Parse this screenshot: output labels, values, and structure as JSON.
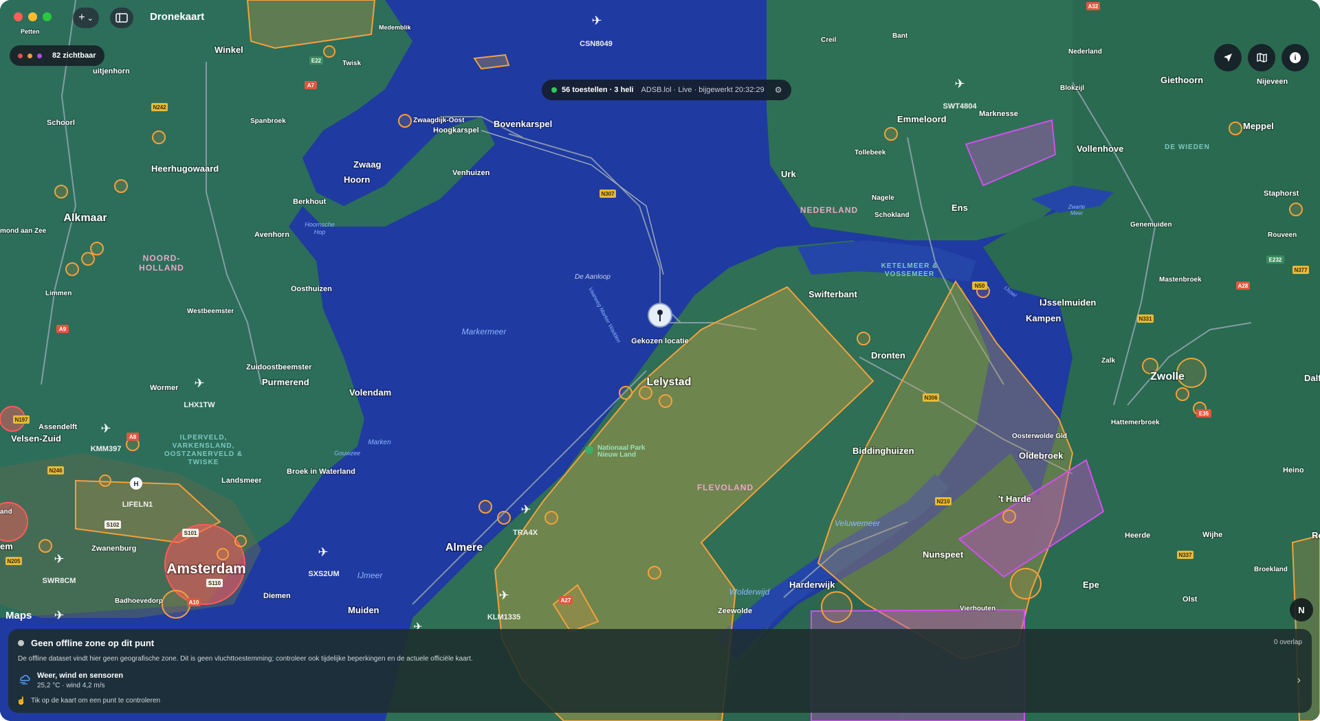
{
  "window": {
    "title": "Dronekaart"
  },
  "toolbar": {
    "add_label": "+",
    "add_chevron": "⌄",
    "sidebar_icon": "sidebar-icon"
  },
  "visible_pill": {
    "text": "82 zichtbaar",
    "dot_colors": [
      "#e14f4f",
      "#f09a3a",
      "#b04ee0"
    ]
  },
  "status_pill": {
    "counts": "56 toestellen · 3 heli",
    "details": "ADSB.lol · Live · bijgewerkt 20:32:29",
    "live_color": "#34c759"
  },
  "right_buttons": [
    {
      "name": "location-arrow-icon",
      "glyph": "➤"
    },
    {
      "name": "map-icon",
      "glyph": "▥"
    },
    {
      "name": "info-icon",
      "glyph": "i"
    }
  ],
  "map": {
    "attribution": "Maps",
    "compass": "N",
    "chosen_location": "Gekozen locatie",
    "cities": {
      "alkmaar": "Alkmaar",
      "lelystad": "Lelystad",
      "almere": "Almere",
      "zwolle": "Zwolle",
      "amsterdam": "Amsterdam",
      "emmeloord": "Emmeloord",
      "kampen": "Kampen",
      "dronten": "Dronten",
      "hoorn": "Hoorn",
      "zwaag": "Zwaag",
      "purmerend": "Purmerend",
      "volendam": "Volendam",
      "harderwijk": "Harderwijk",
      "biddinghuizen": "Biddinghuizen",
      "swifterbant": "Swifterbant",
      "oldebroek": "Oldebroek",
      "nunspeet": "Nunspeet",
      "epe": "Epe",
      "heerhugowaard": "Heerhugowaard",
      "bovenkarspel": "Bovenkarspel",
      "giethoorn": "Giethoorn",
      "vollenhove": "Vollenhove",
      "ijsselmuiden": "IJsselmuiden",
      "t_harde": "'t Harde",
      "urk": "Urk",
      "ens": "Ens",
      "meppel": "Meppel",
      "muiden": "Muiden",
      "diemen": "Diemen",
      "velsen_zuid": "Velsen-Zuid",
      "landsmeer": "Landsmeer",
      "broek": "Broek in Waterland",
      "wormer": "Wormer",
      "winkel": "Winkel",
      "schoorl": "Schoorl",
      "zwanenburg": "Zwanenburg",
      "heerde": "Heerde",
      "heino": "Heino",
      "olst": "Olst",
      "wijhe": "Wijhe",
      "marknesse": "Marknesse",
      "staphorst": "Staphorst",
      "zeewolde": "Zeewolde",
      "oosthuizen": "Oosthuizen",
      "avenhorn": "Avenhorn",
      "berkhout": "Berkhout",
      "venhuizen": "Venhuizen",
      "hoogkarspel": "Hoogkarspel",
      "zwaagdijk": "Zwaagdijk-Oost",
      "zuidoostbeemster": "Zuidoostbeemster",
      "westbeemster": "Westbeemster",
      "limmen": "Limmen",
      "uitjenhorn": "uitjenhorn",
      "twisk": "Twisk",
      "spanbroek": "Spanbroek",
      "assendelft": "Assendelft",
      "badhoevedorp": "Badhoevedorp",
      "nijeveen": "Nijeveen",
      "blokzijl": "Blokzijl",
      "nederland_town": "Nederland",
      "creil": "Creil",
      "bant": "Bant",
      "tollebeek": "Tollebeek",
      "nagele": "Nagele",
      "schokland": "Schokland",
      "genemuiden": "Genemuiden",
      "rouveen": "Rouveen",
      "mastenbroek": "Mastenbroek",
      "zalk": "Zalk",
      "hattemerbroek": "Hattemerbroek",
      "oosterwolde": "Oosterwolde Gld",
      "vierhouten": "Vierhouten",
      "broekland": "Broekland",
      "mond_aan_zee": "mond aan Zee",
      "petten": "Petten",
      "medemblik": "Medemblik",
      "dalf": "Dalf",
      "ro": "Ro",
      "em": "em",
      "and": "and"
    },
    "regions": {
      "noord_holland_1": "NOORD-",
      "noord_holland_2": "HOLLAND",
      "flevoland": "FLEVOLAND",
      "nederland": "NEDERLAND",
      "de_wieden": "DE WIEDEN",
      "ketelmeer_1": "KETELMEER &",
      "ketelmeer_2": "VOSSEMEER",
      "ilperveld_1": "ILPERVELD,",
      "ilperveld_2": "VARKENSLAND,",
      "ilperveld_3": "OOSTZANERVELD &",
      "ilperveld_4": "TWISKE"
    },
    "waters": {
      "markermeer": "Markermeer",
      "ijmeer": "IJmeer",
      "gouwzee": "Gouwzee",
      "marken": "Marken",
      "veluwemeer": "Veluwemeer",
      "wolderwijd": "Wolderwijd",
      "de_aanloop": "De Aanloop",
      "hoornsche_1": "Hoornsche",
      "hoornsche_2": "Hop",
      "vaarweg": "Vaarweg Marker Wadden",
      "zwarte_1": "Zwarte",
      "zwarte_2": "Meer",
      "ijssel": "IJssel"
    },
    "park": {
      "line1": "Nationaal Park",
      "line2": "Nieuw Land"
    },
    "roads": {
      "n307": "N307",
      "n242": "N242",
      "a7": "A7",
      "e22": "E22",
      "a9": "A9",
      "a8": "A8",
      "a10": "A10",
      "s102": "S102",
      "s101": "S101",
      "s110": "S110",
      "n246": "N246",
      "n205": "N205",
      "n197": "N197",
      "a27": "A27",
      "n306": "N306",
      "n210": "N210",
      "n50": "N50",
      "a28": "A28",
      "n331": "N331",
      "n377": "N377",
      "n337": "N337",
      "a32": "A32",
      "e35": "E35",
      "e232": "E232"
    },
    "aircraft": [
      {
        "callsign": "CSN8049"
      },
      {
        "callsign": "SWT4804"
      },
      {
        "callsign": "LHX1TW"
      },
      {
        "callsign": "KMM397"
      },
      {
        "callsign": "LIFELN1"
      },
      {
        "callsign": "SWR8CM"
      },
      {
        "callsign": "SXS2UM"
      },
      {
        "callsign": "TRA4X"
      },
      {
        "callsign": "KLM1335"
      }
    ],
    "zone_colors": {
      "orange": "#f5a13b",
      "magenta": "#d24ff0",
      "red": "#ff5959"
    }
  },
  "panel": {
    "title": "Geen offline zone op dit punt",
    "overlap": "0 overlap",
    "description": "De offline dataset vindt hier geen geografische zone. Dit is geen vluchttoestemming; controleer ook tijdelijke beperkingen en de actuele officiële kaart.",
    "weather_title": "Weer, wind en sensoren",
    "weather_detail": "25,2 °C · wind 4,2 m/s",
    "hint": "Tik op de kaart om een punt te controleren",
    "chevron": "›"
  }
}
